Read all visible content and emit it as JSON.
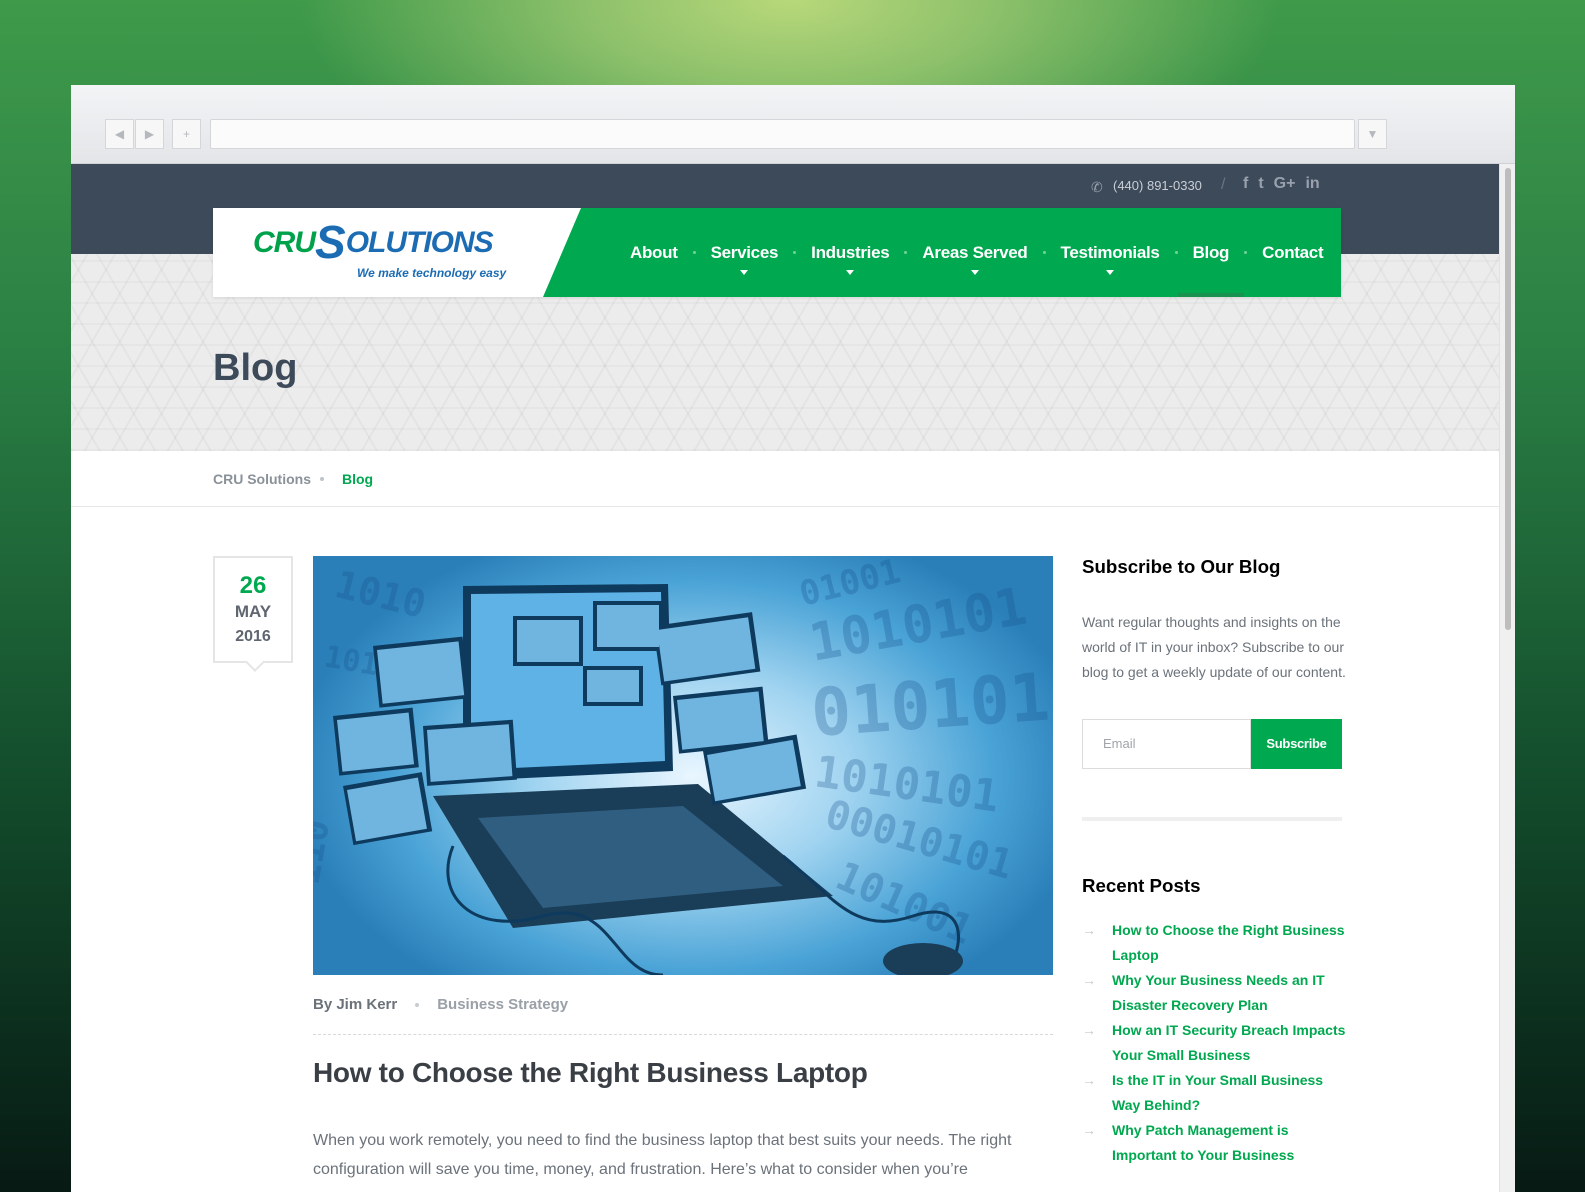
{
  "topbar": {
    "phone": "(440) 891-0330",
    "social": [
      "f",
      "t",
      "G+",
      "in"
    ]
  },
  "logo": {
    "part1": "CRU",
    "part2": "OLUTIONS",
    "s": "S",
    "tagline": "We make technology easy"
  },
  "nav": {
    "items": [
      {
        "label": "About",
        "dropdown": false
      },
      {
        "label": "Services",
        "dropdown": true
      },
      {
        "label": "Industries",
        "dropdown": true
      },
      {
        "label": "Areas Served",
        "dropdown": true
      },
      {
        "label": "Testimonials",
        "dropdown": true
      },
      {
        "label": "Blog",
        "dropdown": false,
        "active": true
      },
      {
        "label": "Contact",
        "dropdown": false
      }
    ]
  },
  "hero": {
    "title": "Blog"
  },
  "breadcrumb": {
    "home": "CRU Solutions",
    "current": "Blog"
  },
  "post": {
    "day": "26",
    "month": "MAY",
    "year": "2016",
    "author": "By Jim Kerr",
    "category": "Business Strategy",
    "title": "How to Choose the Right Business Laptop",
    "body": "When you work remotely, you need to find the business laptop that best suits your needs.  The right configuration will save you time, money, and frustration.  Here’s what to consider when you’re"
  },
  "sidebar": {
    "subscribe_title": "Subscribe to Our Blog",
    "subscribe_text": "Want regular thoughts and insights on the world of IT in your inbox? Subscribe to our blog to get a weekly update of our content.",
    "email_placeholder": "Email",
    "subscribe_button": "Subscribe",
    "recent_title": "Recent Posts",
    "recent_posts": [
      "How to Choose the Right Business Laptop",
      "Why Your Business Needs an IT Disaster Recovery Plan",
      "How an IT Security Breach Impacts Your Small Business",
      "Is the IT in Your Small Business Way Behind?",
      "Why Patch Management is Important to Your Business"
    ]
  },
  "colors": {
    "accent": "#00a84f",
    "dark": "#3d4a5a",
    "brand_blue": "#1c6cb4"
  }
}
